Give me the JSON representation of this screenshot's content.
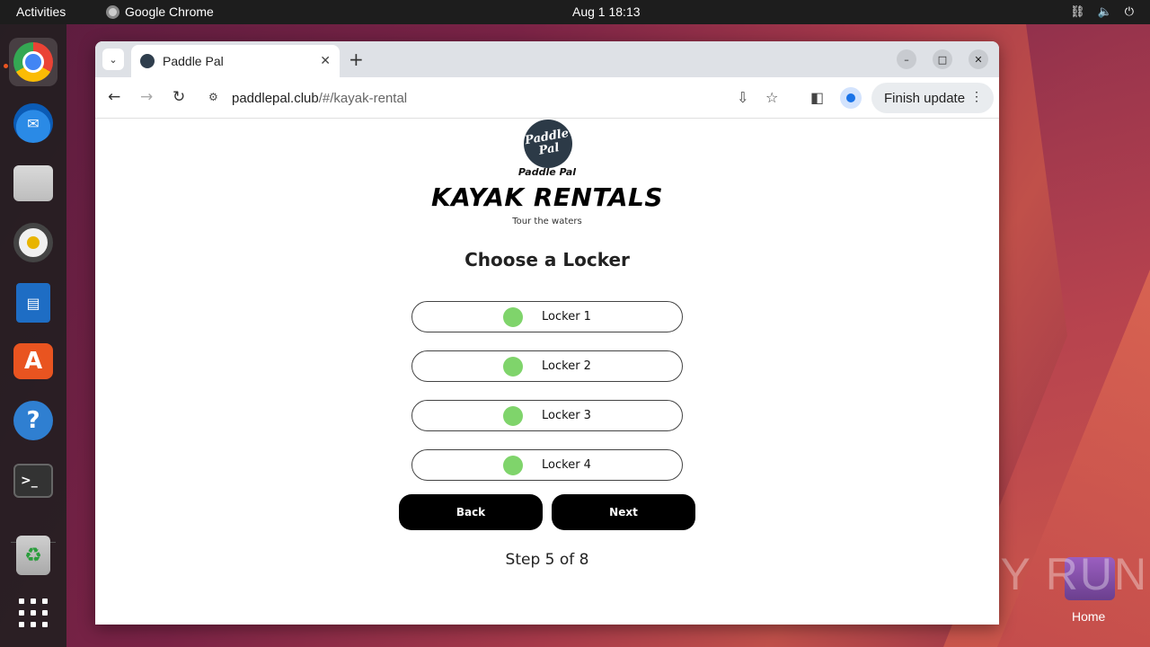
{
  "system": {
    "activities": "Activities",
    "app_name": "Google Chrome",
    "clock": "Aug 1  18:13",
    "tray": [
      "network-icon",
      "volume-icon",
      "power-icon"
    ]
  },
  "desktop": {
    "home_label": "Home",
    "watermark": "ANY RUN"
  },
  "browser": {
    "tab_title": "Paddle Pal",
    "url_host": "paddlepal.club",
    "url_path": "/#/kayak-rental",
    "finish_update": "Finish update"
  },
  "page": {
    "logo_line1": "Paddle",
    "logo_line2": "Pal",
    "logo_caption": "Paddle Pal",
    "title": "KAYAK RENTALS",
    "subtitle": "Tour the waters",
    "heading": "Choose a Locker",
    "lockers": [
      {
        "label": "Locker 1",
        "status_color": "#7fd46b"
      },
      {
        "label": "Locker 2",
        "status_color": "#7fd46b"
      },
      {
        "label": "Locker 3",
        "status_color": "#7fd46b"
      },
      {
        "label": "Locker 4",
        "status_color": "#7fd46b"
      }
    ],
    "back_label": "Back",
    "next_label": "Next",
    "step_text": "Step 5 of 8"
  }
}
